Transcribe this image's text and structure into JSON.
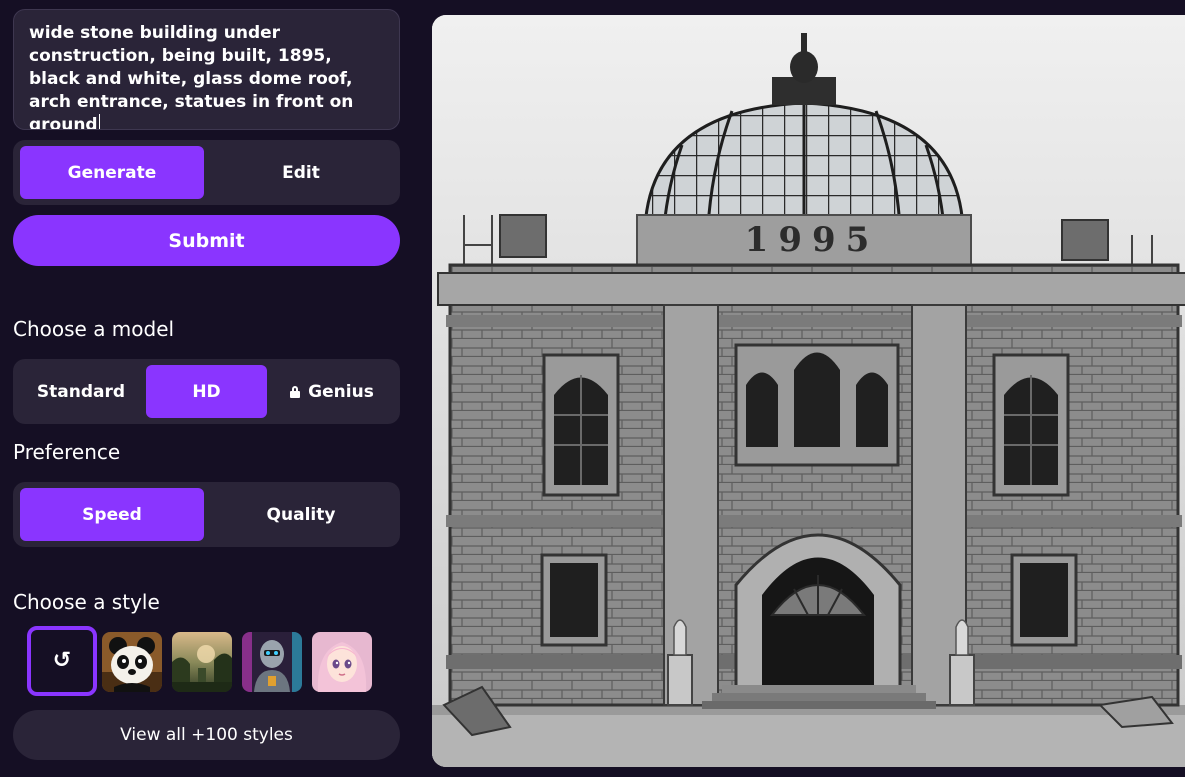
{
  "prompt": {
    "text": "wide stone building under construction, being built, 1895, black and white, glass dome roof, arch entrance, statues in front on ground"
  },
  "mode_tabs": {
    "generate_label": "Generate",
    "edit_label": "Edit",
    "active": "Generate"
  },
  "submit_label": "Submit",
  "model": {
    "title": "Choose a model",
    "options": [
      "Standard",
      "HD",
      "Genius"
    ],
    "selected": "HD",
    "locked": [
      "Genius"
    ]
  },
  "preference": {
    "title": "Preference",
    "options": [
      "Speed",
      "Quality"
    ],
    "selected": "Speed"
  },
  "style": {
    "title": "Choose a style",
    "thumbnails": [
      "no-style",
      "panda",
      "jungle-landscape",
      "robot",
      "anime-girl"
    ],
    "selected": "no-style",
    "view_all_label": "View all +100 styles"
  },
  "result_image": {
    "carved_text": "1995",
    "description_icon": "generated-image"
  },
  "colors": {
    "background": "#150f24",
    "panel": "#2a2438",
    "accent": "#8a35ff"
  }
}
